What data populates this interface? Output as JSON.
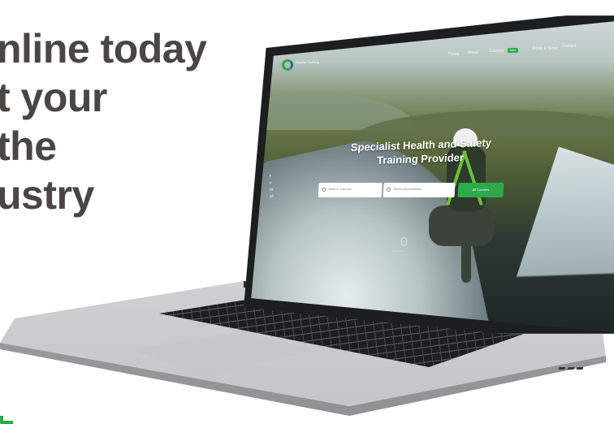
{
  "headline": {
    "lines": [
      "nline today",
      "t your",
      "the",
      "ustry"
    ]
  },
  "website": {
    "logo_text": "Sunrise Training",
    "nav": {
      "home": "Home",
      "about": "About",
      "courses": "Courses",
      "courses_badge": "New",
      "news": "Posts & News",
      "contact": "Contact"
    },
    "hero": {
      "title_line1": "Specialist Health and Safety",
      "title_line2": "Training Provider"
    },
    "search": {
      "field1_placeholder": "Search Courses",
      "field2_placeholder": "Select Accreditation",
      "button_label": "All Courses"
    },
    "social_icons": [
      "f",
      "t",
      "in",
      "yt"
    ],
    "scroll_hint": "scroll down"
  },
  "colors": {
    "headline": "#4a4644",
    "accent_green": "#2eaa4b",
    "brand_blue": "#1c6fa8"
  }
}
